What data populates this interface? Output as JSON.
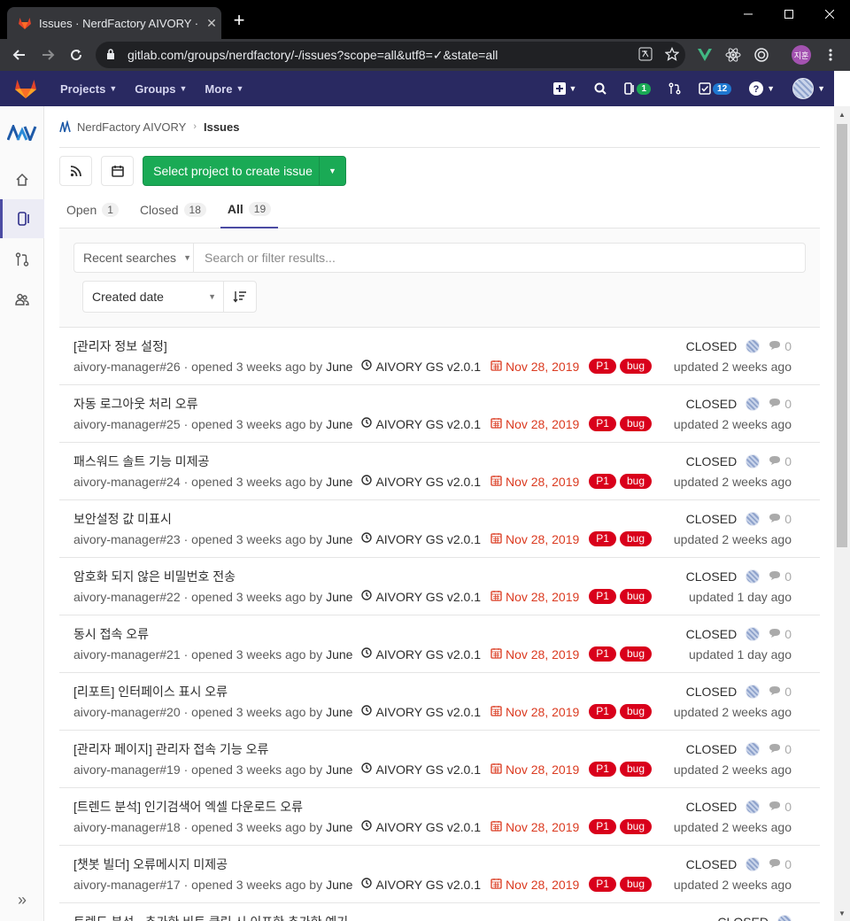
{
  "browser": {
    "tab_title": "Issues · NerdFactory AIVORY · G",
    "tab_close": "✕",
    "new_tab": "+",
    "url": "gitlab.com/groups/nerdfactory/-/issues?scope=all&utf8=✓&state=all",
    "profile_initials": "지훈"
  },
  "gitlab_header": {
    "menu": [
      {
        "label": "Projects"
      },
      {
        "label": "Groups"
      },
      {
        "label": "More"
      }
    ],
    "issues_badge": "1",
    "todos_badge": "12"
  },
  "breadcrumb": {
    "group": "NerdFactory AIVORY",
    "current": "Issues"
  },
  "actions": {
    "create_issue_label": "Select project to create issue"
  },
  "tabs": [
    {
      "label": "Open",
      "count": "1"
    },
    {
      "label": "Closed",
      "count": "18"
    },
    {
      "label": "All",
      "count": "19",
      "active": true
    }
  ],
  "filter": {
    "recent_searches": "Recent searches",
    "search_placeholder": "Search or filter results...",
    "sort_label": "Created date"
  },
  "colors": {
    "label_p1": "#d9001b",
    "label_bug": "#d9001b",
    "accent": "#4b4ba3",
    "header_bg": "#292961",
    "primary_button": "#1aaa55",
    "due_date": "#db3b21"
  },
  "issues": [
    {
      "title": "[관리자 정보 설정]",
      "ref": "aivory-manager#26",
      "opened": "· opened 3 weeks ago by",
      "author": "June",
      "milestone": "AIVORY GS v2.0.1",
      "due": "Nov 28, 2019",
      "labels": [
        "P1",
        "bug"
      ],
      "status": "CLOSED",
      "comments": "0",
      "updated": "updated 2 weeks ago"
    },
    {
      "title": "자동 로그아웃 처리 오류",
      "ref": "aivory-manager#25",
      "opened": "· opened 3 weeks ago by",
      "author": "June",
      "milestone": "AIVORY GS v2.0.1",
      "due": "Nov 28, 2019",
      "labels": [
        "P1",
        "bug"
      ],
      "status": "CLOSED",
      "comments": "0",
      "updated": "updated 2 weeks ago"
    },
    {
      "title": "패스워드 솔트 기능 미제공",
      "ref": "aivory-manager#24",
      "opened": "· opened 3 weeks ago by",
      "author": "June",
      "milestone": "AIVORY GS v2.0.1",
      "due": "Nov 28, 2019",
      "labels": [
        "P1",
        "bug"
      ],
      "status": "CLOSED",
      "comments": "0",
      "updated": "updated 2 weeks ago"
    },
    {
      "title": "보안설정 값 미표시",
      "ref": "aivory-manager#23",
      "opened": "· opened 3 weeks ago by",
      "author": "June",
      "milestone": "AIVORY GS v2.0.1",
      "due": "Nov 28, 2019",
      "labels": [
        "P1",
        "bug"
      ],
      "status": "CLOSED",
      "comments": "0",
      "updated": "updated 2 weeks ago"
    },
    {
      "title": "암호화 되지 않은 비밀번호 전송",
      "ref": "aivory-manager#22",
      "opened": "· opened 3 weeks ago by",
      "author": "June",
      "milestone": "AIVORY GS v2.0.1",
      "due": "Nov 28, 2019",
      "labels": [
        "P1",
        "bug"
      ],
      "status": "CLOSED",
      "comments": "0",
      "updated": "updated 1 day ago"
    },
    {
      "title": "동시 접속 오류",
      "ref": "aivory-manager#21",
      "opened": "· opened 3 weeks ago by",
      "author": "June",
      "milestone": "AIVORY GS v2.0.1",
      "due": "Nov 28, 2019",
      "labels": [
        "P1",
        "bug"
      ],
      "status": "CLOSED",
      "comments": "0",
      "updated": "updated 1 day ago"
    },
    {
      "title": "[리포트] 인터페이스 표시 오류",
      "ref": "aivory-manager#20",
      "opened": "· opened 3 weeks ago by",
      "author": "June",
      "milestone": "AIVORY GS v2.0.1",
      "due": "Nov 28, 2019",
      "labels": [
        "P1",
        "bug"
      ],
      "status": "CLOSED",
      "comments": "0",
      "updated": "updated 2 weeks ago"
    },
    {
      "title": "[관리자 페이지] 관리자 접속 기능 오류",
      "ref": "aivory-manager#19",
      "opened": "· opened 3 weeks ago by",
      "author": "June",
      "milestone": "AIVORY GS v2.0.1",
      "due": "Nov 28, 2019",
      "labels": [
        "P1",
        "bug"
      ],
      "status": "CLOSED",
      "comments": "0",
      "updated": "updated 2 weeks ago"
    },
    {
      "title": "[트렌드 분석] 인기검색어 엑셀 다운로드 오류",
      "ref": "aivory-manager#18",
      "opened": "· opened 3 weeks ago by",
      "author": "June",
      "milestone": "AIVORY GS v2.0.1",
      "due": "Nov 28, 2019",
      "labels": [
        "P1",
        "bug"
      ],
      "status": "CLOSED",
      "comments": "0",
      "updated": "updated 2 weeks ago"
    },
    {
      "title": "[챗봇 빌더] 오류메시지 미제공",
      "ref": "aivory-manager#17",
      "opened": "· opened 3 weeks ago by",
      "author": "June",
      "milestone": "AIVORY GS v2.0.1",
      "due": "Nov 28, 2019",
      "labels": [
        "P1",
        "bug"
      ],
      "status": "CLOSED",
      "comments": "0",
      "updated": "updated 2 weeks ago"
    },
    {
      "title": "트렌드 분석 - 추가한 비트 클릭 시 이프한 추가한 예기",
      "ref": "",
      "opened": "",
      "author": "",
      "milestone": "",
      "due": "",
      "labels": [],
      "status": "CLOSED",
      "comments": "",
      "updated": ""
    }
  ]
}
